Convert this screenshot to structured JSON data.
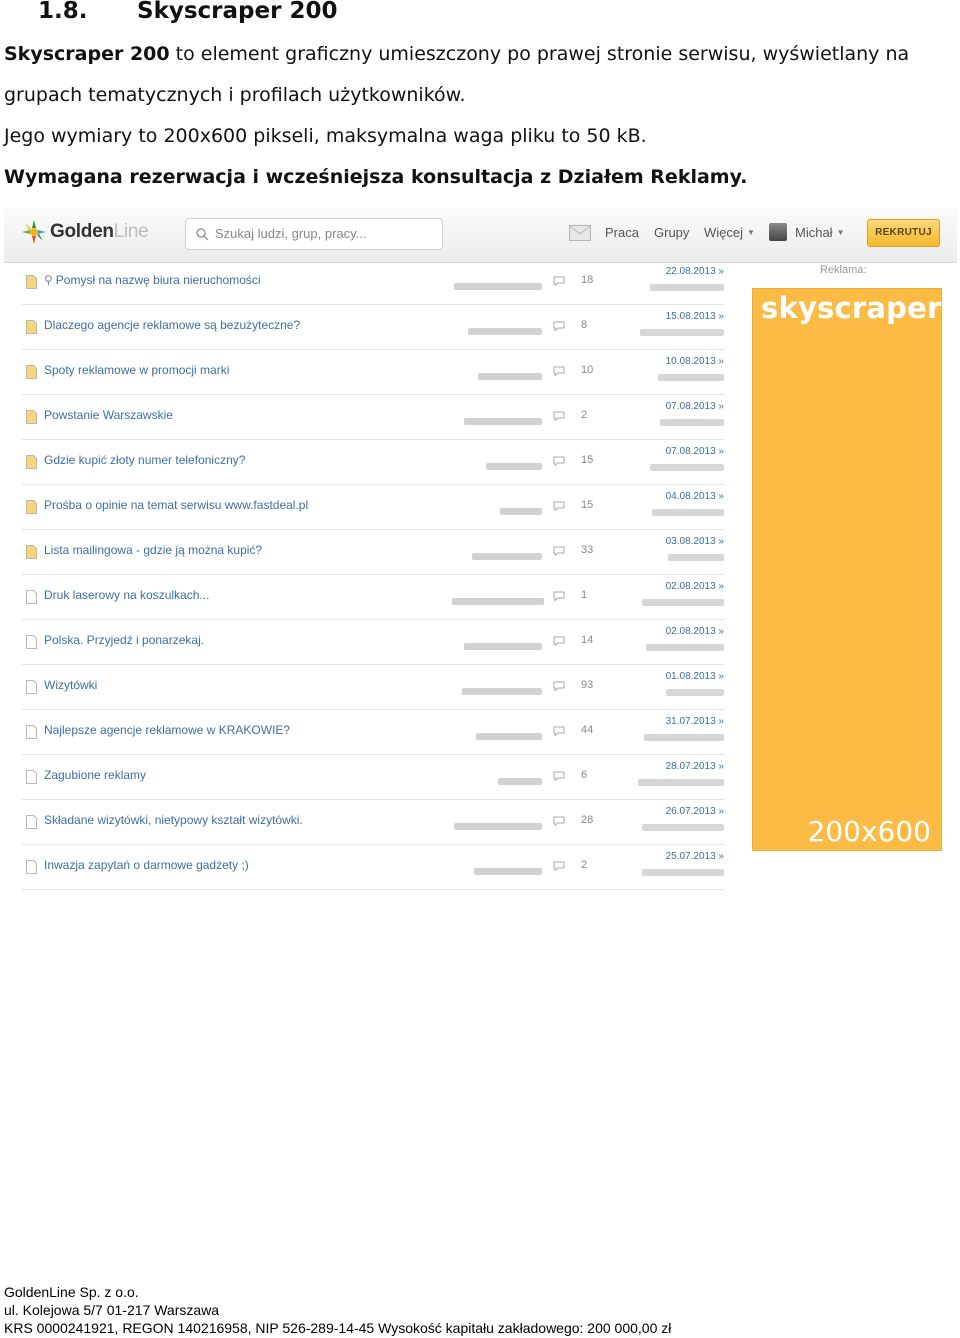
{
  "document": {
    "heading_number": "1.8.",
    "heading_title": "Skyscraper 200",
    "p1_bold": "Skyscraper 200",
    "p1_rest": " to element graficzny umieszczony po prawej stronie serwisu,  wyświetlany na grupach tematycznych i profilach użytkowników.",
    "p2": "Jego wymiary to 200x600 pikseli, maksymalna waga pliku to 50 kB.",
    "p3": "Wymagana rezerwacja i wcześniejsza konsultacja z Działem Reklamy."
  },
  "screenshot": {
    "logo": {
      "part1": "Golden",
      "part2": "Line"
    },
    "search": {
      "placeholder": "Szukaj ludzi, grup, pracy..."
    },
    "nav": {
      "praca": "Praca",
      "grupy": "Grupy",
      "wiecej": "Więcej",
      "user": "Michał"
    },
    "recruit_button": "REKRUTUJ",
    "ad": {
      "label": "Reklama:",
      "word": "skyscraper",
      "size": "200x600"
    },
    "topics": [
      {
        "title": "Pomysł na nazwę biura nieruchomości",
        "count": "18",
        "date": "22.08.2013 »",
        "pinned": true
      },
      {
        "title": "Dlaczego agencje reklamowe są bezużyteczne?",
        "count": "8",
        "date": "15.08.2013 »"
      },
      {
        "title": "Spoty reklamowe w promocji marki",
        "count": "10",
        "date": "10.08.2013 »"
      },
      {
        "title": "Powstanie Warszawskie",
        "count": "2",
        "date": "07.08.2013 »"
      },
      {
        "title": "Gdzie kupić złoty numer telefoniczny?",
        "count": "15",
        "date": "07.08.2013 »"
      },
      {
        "title": "Prośba o opinie na temat serwisu www.fastdeal.pl",
        "count": "15",
        "date": "04.08.2013 »"
      },
      {
        "title": "Lista mailingowa - gdzie ją można kupić?",
        "count": "33",
        "date": "03.08.2013 »"
      },
      {
        "title": "Druk laserowy na koszulkach...",
        "count": "1",
        "date": "02.08.2013 »"
      },
      {
        "title": "Polska. Przyjedź i ponarzekaj.",
        "count": "14",
        "date": "02.08.2013 »"
      },
      {
        "title": "Wizytówki",
        "count": "93",
        "date": "01.08.2013 »"
      },
      {
        "title": "Najlepsze agencje reklamowe w KRAKOWIE?",
        "count": "44",
        "date": "31.07.2013 »"
      },
      {
        "title": "Zagubione reklamy",
        "count": "6",
        "date": "28.07.2013 »"
      },
      {
        "title": "Składane wizytówki, nietypowy kształt wizytówki.",
        "count": "28",
        "date": "26.07.2013 »"
      },
      {
        "title": "Inwazja zapytań o darmowe gadżety ;)",
        "count": "2",
        "date": "25.07.2013 »"
      }
    ]
  },
  "footer": {
    "line1": "GoldenLine Sp. z o.o.",
    "line2": "ul. Kolejowa 5/7  01-217 Warszawa",
    "line3": "KRS 0000241921, REGON 140216958, NIP 526-289-14-45 Wysokość kapitału zakładowego: 200 000,00 zł"
  },
  "colors": {
    "ad_orange": "#fbbb45",
    "link_blue": "#3b6fa8",
    "button_yellow": "#f4b72e"
  }
}
